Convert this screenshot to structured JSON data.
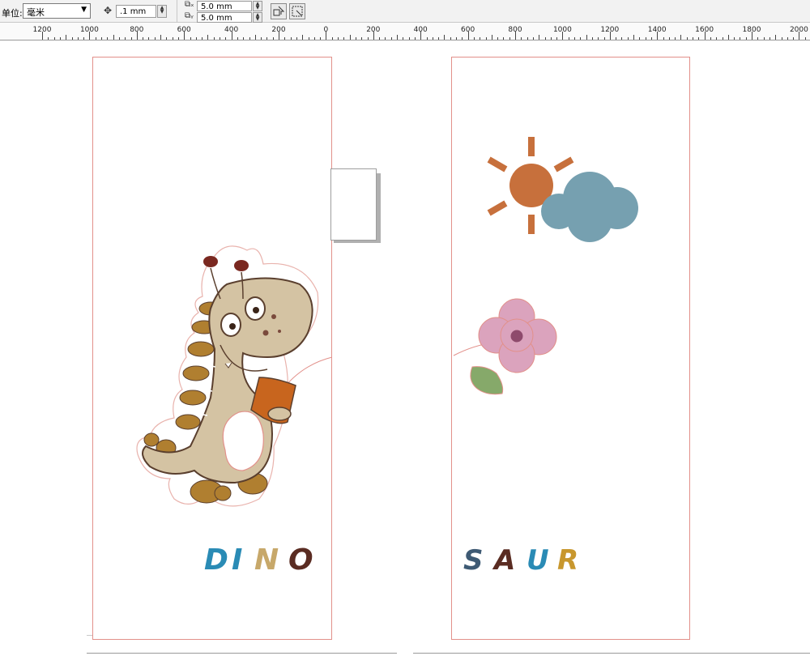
{
  "toolbar": {
    "unit_label": "单位:",
    "unit_value": "毫米",
    "nudge_value": ".1 mm",
    "dup_x_value": "5.0 mm",
    "dup_y_value": "5.0 mm"
  },
  "ruler": {
    "labels": [
      "1200",
      "1000",
      "800",
      "600",
      "400",
      "200",
      "0",
      "200",
      "400",
      "600",
      "800",
      "1000",
      "1200",
      "1400",
      "1600",
      "1800",
      "2000"
    ]
  },
  "artwork": {
    "left_word": "DINO",
    "right_word": "SAUR",
    "letters_left": [
      "D",
      "I",
      "N",
      "O"
    ],
    "letters_right": [
      "S",
      "A",
      "U",
      "R"
    ]
  },
  "colors": {
    "page_border": "#e2908a",
    "dino_body": "#d4c3a3",
    "dino_spikes": "#b07f30",
    "dino_outline": "#5a3f2e",
    "bag": "#c8651e",
    "sun": "#c7703c",
    "cloud": "#76a0b0",
    "flower": "#dba3bd",
    "flower_center": "#8e4a6c",
    "leaf": "#86a96a",
    "letter_blue": "#2a8bb5",
    "letter_tan": "#c7a86a",
    "letter_brown": "#5a2c22",
    "letter_slate": "#3e5a74",
    "letter_gold": "#c8972e"
  }
}
